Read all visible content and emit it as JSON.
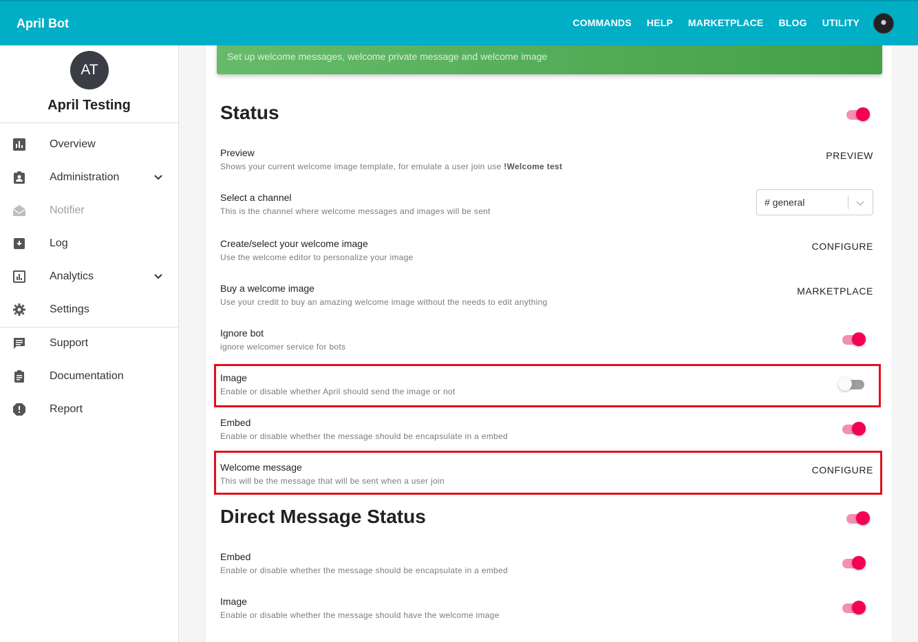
{
  "app": {
    "brand": "April Bot"
  },
  "nav": {
    "commands": "COMMANDS",
    "help": "HELP",
    "marketplace": "MARKETPLACE",
    "blog": "BLOG",
    "utility": "UTILITY"
  },
  "sidebar": {
    "server_initials": "AT",
    "server_name": "April Testing",
    "items": [
      {
        "label": "Overview",
        "icon": "bar-chart-icon"
      },
      {
        "label": "Administration",
        "icon": "badge-icon"
      },
      {
        "label": "Notifier",
        "icon": "mail-open-icon"
      },
      {
        "label": "Log",
        "icon": "archive-icon"
      },
      {
        "label": "Analytics",
        "icon": "analytics-icon"
      },
      {
        "label": "Settings",
        "icon": "gear-icon"
      },
      {
        "label": "Support",
        "icon": "chat-icon"
      },
      {
        "label": "Documentation",
        "icon": "clipboard-icon"
      },
      {
        "label": "Report",
        "icon": "alert-icon"
      }
    ]
  },
  "banner": {
    "text": "Set up welcome messages, welcome private message and welcome image"
  },
  "status": {
    "title": "Status",
    "enabled": true,
    "preview": {
      "title": "Preview",
      "desc": "Shows your current welcome image template, for emulate a user join use ",
      "command": "!Welcome test",
      "action": "PREVIEW"
    },
    "channel": {
      "title": "Select a channel",
      "desc": "This is the channel where welcome messages and images will be sent",
      "value": "# general"
    },
    "create_image": {
      "title": "Create/select your welcome image",
      "desc": "Use the welcome editor to personalize your image",
      "action": "CONFIGURE"
    },
    "buy_image": {
      "title": "Buy a welcome image",
      "desc": "Use your credit to buy an amazing welcome image without the needs to edit anything",
      "action": "MARKETPLACE"
    },
    "ignore_bot": {
      "title": "Ignore bot",
      "desc": "ignore welcomer service for bots",
      "enabled": true
    },
    "image": {
      "title": "Image",
      "desc": "Enable or disable whether April should send the image or not",
      "enabled": false
    },
    "embed": {
      "title": "Embed",
      "desc": "Enable or disable whether the message should be encapsulate in a embed",
      "enabled": true
    },
    "welcome_message": {
      "title": "Welcome message",
      "desc": "This will be the message that will be sent when a user join",
      "action": "CONFIGURE"
    }
  },
  "dm_status": {
    "title": "Direct Message Status",
    "enabled": true,
    "embed": {
      "title": "Embed",
      "desc": "Enable or disable whether the message should be encapsulate in a embed",
      "enabled": true
    },
    "image": {
      "title": "Image",
      "desc": "Enable or disable whether the message should have the welcome image",
      "enabled": true
    }
  },
  "colors": {
    "topbar": "#00aec6",
    "accent": "#f50057",
    "banner": "#4caf50",
    "highlight": "#e0101e"
  }
}
